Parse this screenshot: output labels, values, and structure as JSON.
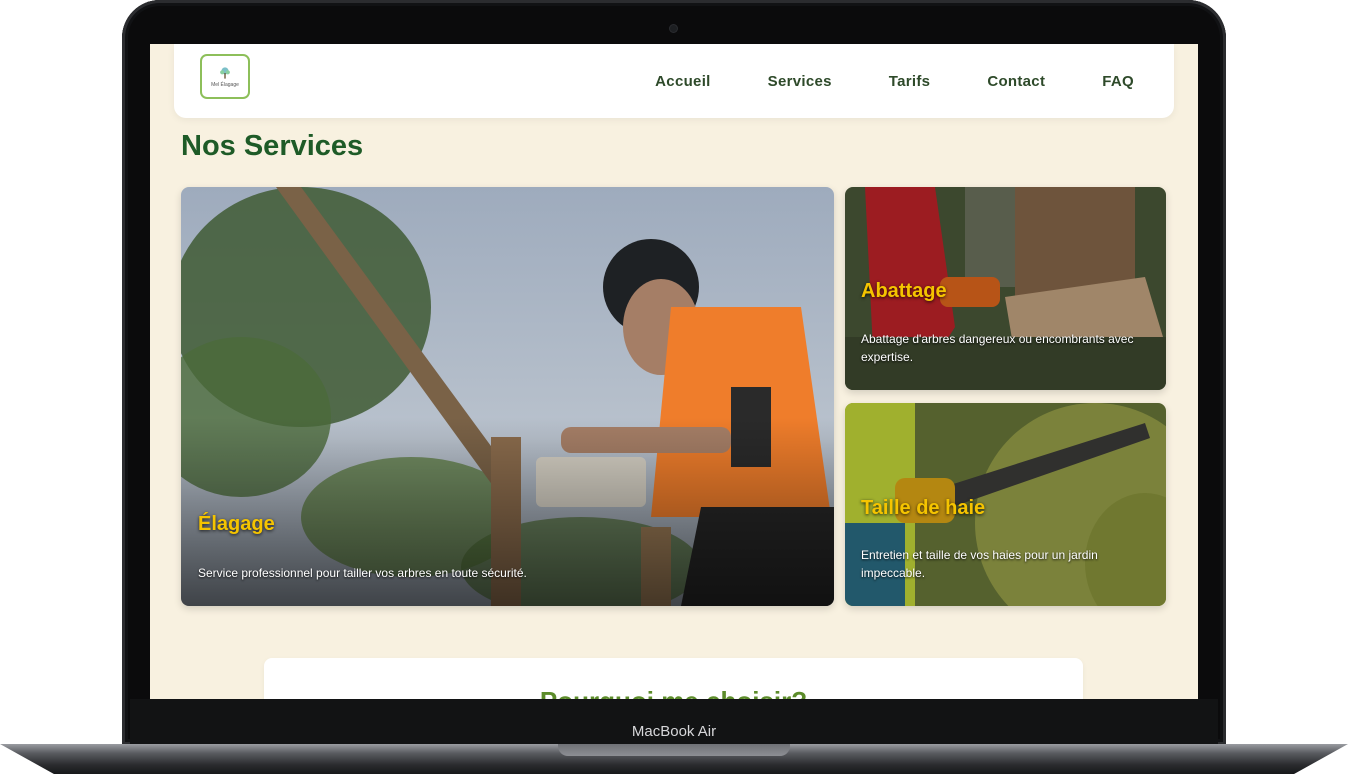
{
  "device": {
    "model_label": "MacBook Air"
  },
  "site": {
    "logo": {
      "text": "Mel Élagage",
      "icon": "tree-icon"
    },
    "nav": [
      {
        "label": "Accueil"
      },
      {
        "label": "Services"
      },
      {
        "label": "Tarifs"
      },
      {
        "label": "Contact"
      },
      {
        "label": "FAQ"
      }
    ],
    "page_title": "Nos Services",
    "services": [
      {
        "title": "Élagage",
        "description": "Service professionnel pour tailler vos arbres en toute sécurité."
      },
      {
        "title": "Abattage",
        "description": "Abattage d'arbres dangereux ou encombrants avec expertise."
      },
      {
        "title": "Taille de haie",
        "description": "Entretien et taille de vos haies pour un jardin impeccable."
      }
    ],
    "why_title": "Pourquoi me choisir?"
  },
  "colors": {
    "background": "#f8f1e0",
    "title_green": "#1e5b27",
    "nav_text": "#2e4a2a",
    "card_title_yellow": "#f5c400",
    "why_green": "#5c8c2a"
  }
}
